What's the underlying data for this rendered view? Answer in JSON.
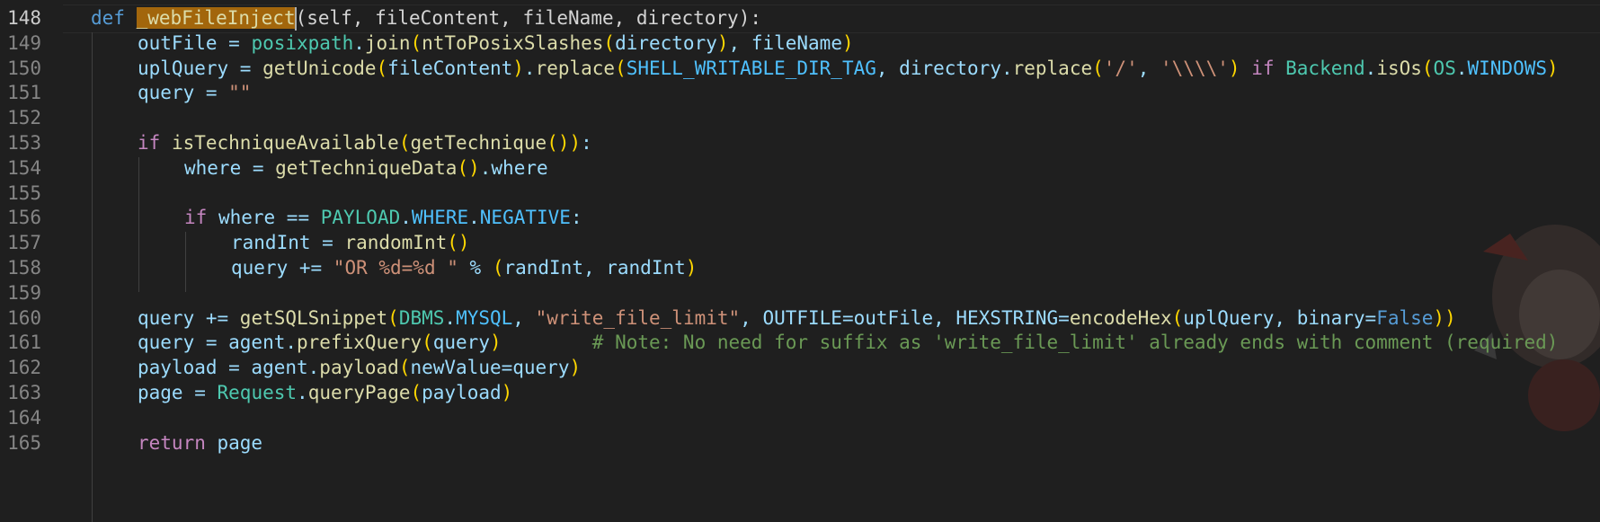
{
  "editor": {
    "active_line": "148",
    "line_numbers": [
      "148",
      "149",
      "150",
      "151",
      "152",
      "153",
      "154",
      "155",
      "156",
      "157",
      "158",
      "159",
      "160",
      "161",
      "162",
      "163",
      "164",
      "165"
    ],
    "function_name": "_webFileInject",
    "def_keyword": "def",
    "lines": {
      "l148_rest": "(self, fileContent, fileName, directory):",
      "l149": "outFile = posixpath.join(ntToPosixSlashes(directory), fileName)",
      "l150": "uplQuery = getUnicode(fileContent).replace(SHELL_WRITABLE_DIR_TAG, directory.replace('/', '\\\\\\\\') if Backend.isOs(OS.WINDOWS)",
      "l151": "query = \"\"",
      "l153": "if isTechniqueAvailable(getTechnique()):",
      "l154": "where = getTechniqueData().where",
      "l156": "if where == PAYLOAD.WHERE.NEGATIVE:",
      "l157": "randInt = randomInt()",
      "l158": "query += \"OR %d=%d \" % (randInt, randInt)",
      "l160": "query += getSQLSnippet(DBMS.MYSQL, \"write_file_limit\", OUTFILE=outFile, HEXSTRING=encodeHex(uplQuery, binary=False))",
      "l161_code": "query = agent.prefixQuery(query)",
      "l161_comment": "# Note: No need for suffix as 'write_file_limit' already ends with comment (required)",
      "l162": "payload = agent.payload(newValue=query)",
      "l163": "page = Request.queryPage(payload)",
      "l165": "return page"
    }
  },
  "colors": {
    "background": "#1f1f1f",
    "keyword": "#569cd6",
    "control": "#c586c0",
    "function": "#dcdcaa",
    "variable": "#9cdcfe",
    "class": "#4ec9b0",
    "constant": "#4fc1ff",
    "string": "#ce9178",
    "comment": "#6a9955",
    "highlight": "#a2660c"
  }
}
